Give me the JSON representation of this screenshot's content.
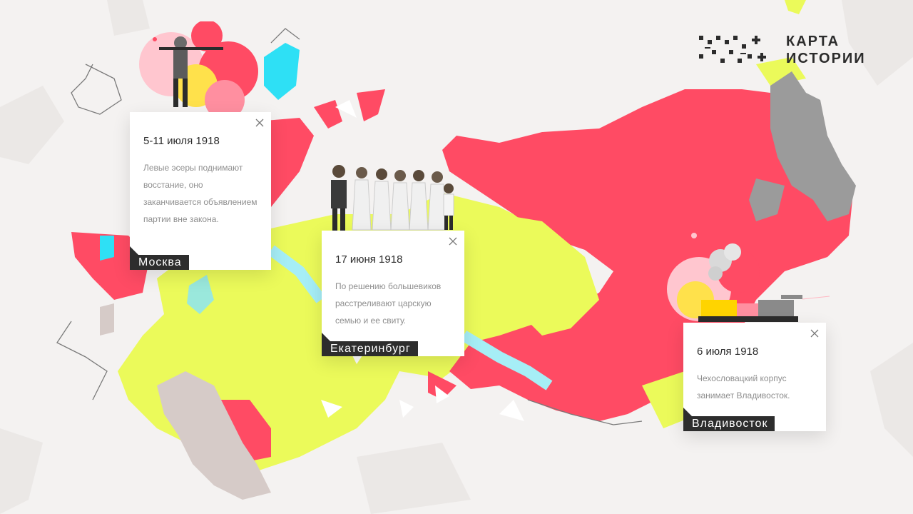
{
  "brand": {
    "line1": "КАРТА",
    "line2": "ИСТОРИИ"
  },
  "colors": {
    "red": "#ff4b64",
    "yellow": "#ebfa5a",
    "cyan": "#2ee0f5",
    "gray": "#9b9b9b",
    "taupe": "#d6cbc8",
    "dark": "#2d2d2d"
  },
  "cards": [
    {
      "date": "5-11 июля 1918",
      "text": "Левые эсеры поднимают восстание, оно заканчивается объявлением партии вне закона.",
      "city": "Москва",
      "illustration": "soldier-with-rifle"
    },
    {
      "date": "17 июня 1918",
      "text": "По решению большевиков расстреливают царскую семью и ее свиту.",
      "city": "Екатеринбург",
      "illustration": "royal-family"
    },
    {
      "date": "6 июля 1918",
      "text": "Чехословацкий корпус занимает Владивосток.",
      "city": "Владивосток",
      "illustration": "armored-train"
    }
  ]
}
